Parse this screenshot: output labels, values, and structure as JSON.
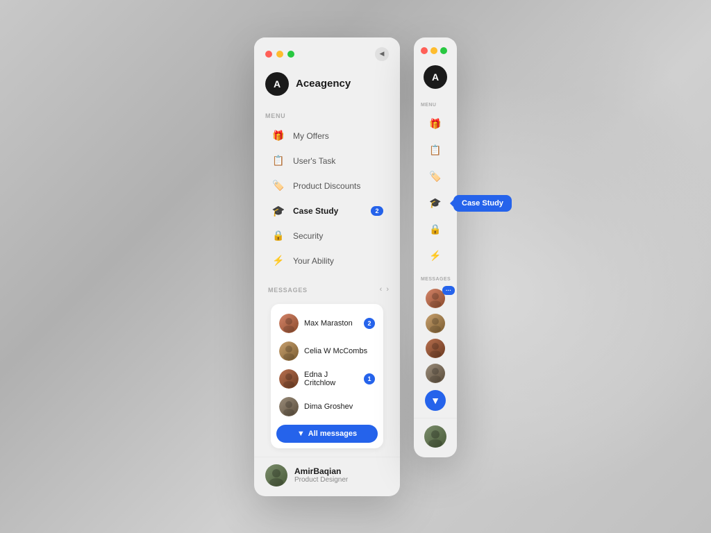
{
  "background": {
    "color": "#c8c8c8"
  },
  "panels": {
    "expanded": {
      "window_controls": {
        "red": "#ff5f57",
        "yellow": "#febc2e",
        "green": "#28c840"
      },
      "brand": {
        "logo_text": "A",
        "name": "Aceagency"
      },
      "menu_section_label": "MENU",
      "menu_items": [
        {
          "id": "my-offers",
          "icon": "🎁",
          "label": "My Offers",
          "active": false,
          "badge": null
        },
        {
          "id": "users-task",
          "icon": "📋",
          "label": "User's Task",
          "active": false,
          "badge": null
        },
        {
          "id": "product-discounts",
          "icon": "🏷️",
          "label": "Product Discounts",
          "active": false,
          "badge": null
        },
        {
          "id": "case-study",
          "icon": "🎓",
          "label": "Case Study",
          "active": true,
          "badge": "2"
        },
        {
          "id": "security",
          "icon": "🔒",
          "label": "Security",
          "active": false,
          "badge": null
        },
        {
          "id": "your-ability",
          "icon": "⚡",
          "label": "Your Ability",
          "active": false,
          "badge": null
        }
      ],
      "messages_section_label": "MESSAGES",
      "messages": [
        {
          "id": "max",
          "name": "Max Maraston",
          "badge": "2",
          "avatar_color": "#c87a50"
        },
        {
          "id": "celia",
          "name": "Celia W McCombs",
          "badge": null,
          "avatar_color": "#c8956a"
        },
        {
          "id": "edna",
          "name": "Edna J Critchlow",
          "badge": "1",
          "avatar_color": "#a06040"
        },
        {
          "id": "dima",
          "name": "Dima Groshev",
          "badge": null,
          "avatar_color": "#8a7c6a"
        }
      ],
      "all_messages_btn": "All messages",
      "profile": {
        "name": "AmirBaqian",
        "role": "Product Designer",
        "avatar_color": "#6a7a5a"
      }
    },
    "collapsed": {
      "window_controls": {
        "red": "#ff5f57",
        "yellow": "#febc2e",
        "green": "#28c840"
      },
      "brand_logo": "A",
      "menu_section_label": "MENU",
      "active_item": "case-study",
      "tooltip_text": "Case Study",
      "messages_section_label": "MESSAGES",
      "messages": [
        {
          "id": "max",
          "avatar_color": "#c87a50",
          "has_badge": true,
          "badge_text": "···"
        },
        {
          "id": "celia",
          "avatar_color": "#c8956a",
          "has_badge": false
        },
        {
          "id": "edna",
          "avatar_color": "#a06040",
          "has_badge": false
        },
        {
          "id": "dima",
          "avatar_color": "#8a7c6a",
          "has_badge": false
        }
      ],
      "all_messages_btn_icon": "▼",
      "profile": {
        "avatar_color": "#6a7a5a"
      }
    }
  }
}
